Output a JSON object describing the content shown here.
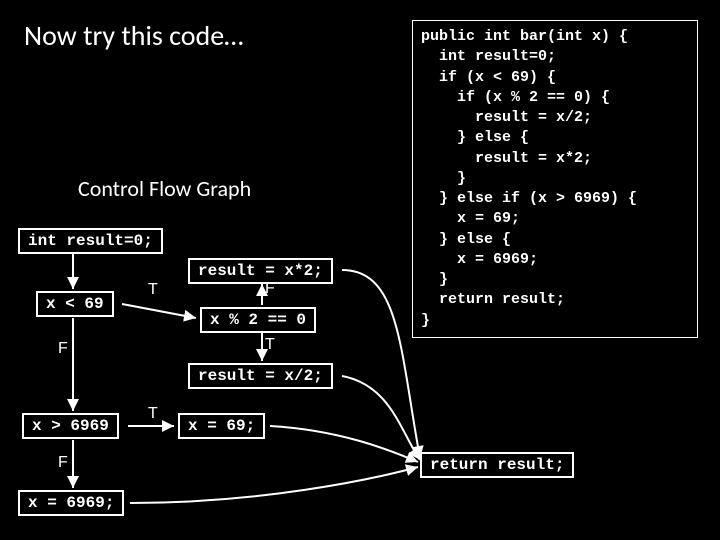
{
  "title": "Now try this code…",
  "subtitle": "Control Flow Graph",
  "code": "public int bar(int x) {\n  int result=0;\n  if (x < 69) {\n    if (x % 2 == 0) {\n      result = x/2;\n    } else {\n      result = x*2;\n    }\n  } else if (x > 6969) {\n    x = 69;\n  } else {\n    x = 6969;\n  }\n  return result;\n}",
  "nodes": {
    "init": "int result=0;",
    "c1": "x < 69",
    "mul": "result = x*2;",
    "mod": "x % 2 == 0",
    "div": "result = x/2;",
    "c2": "x > 6969",
    "a69": "x = 69;",
    "a6969": "x = 6969;",
    "ret": "return result;"
  },
  "labels": {
    "t": "T",
    "f": "F"
  }
}
